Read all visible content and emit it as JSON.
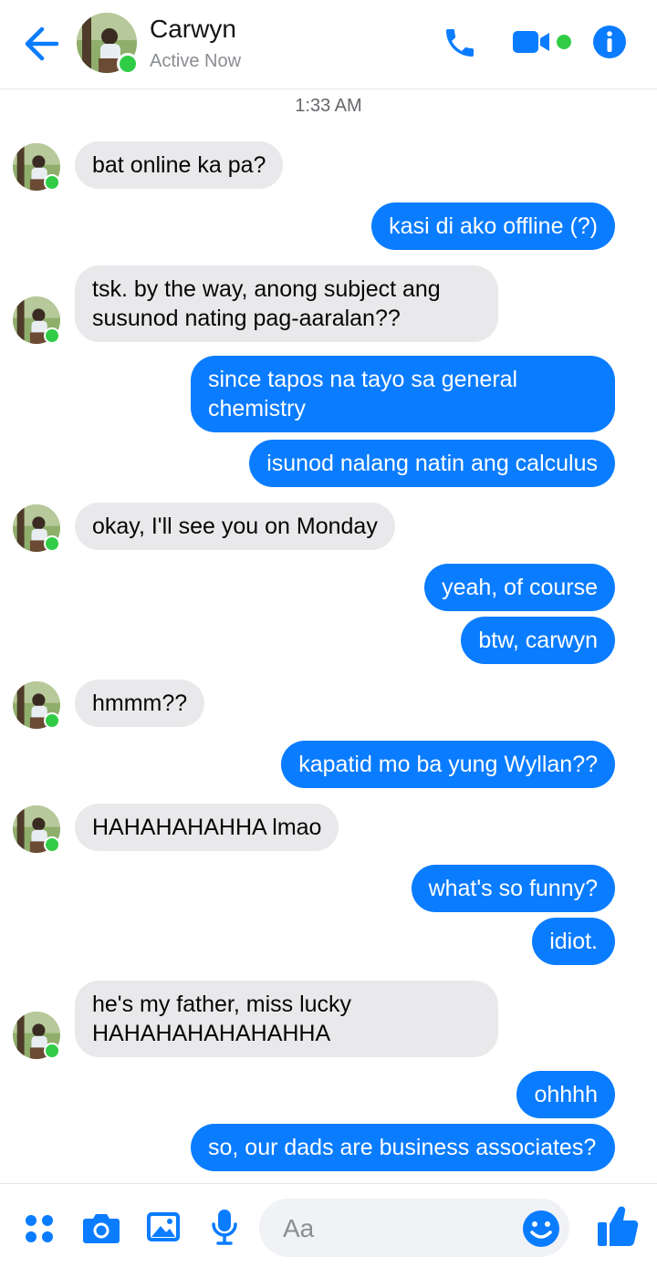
{
  "header": {
    "contact_name": "Carwyn",
    "status": "Active Now"
  },
  "chat": {
    "timestamp": "1:33 AM",
    "messages": [
      {
        "from": "them",
        "text": "bat online ka pa?"
      },
      {
        "from": "me",
        "text": "kasi di ako offline (?)"
      },
      {
        "from": "them",
        "text": "tsk. by the way, anong subject ang susunod nating pag-aaralan??"
      },
      {
        "from": "me",
        "text": "since tapos na tayo sa general chemistry"
      },
      {
        "from": "me",
        "text": "isunod nalang natin ang calculus"
      },
      {
        "from": "them",
        "text": "okay, I'll see you on Monday"
      },
      {
        "from": "me",
        "text": "yeah, of course"
      },
      {
        "from": "me",
        "text": "btw, carwyn"
      },
      {
        "from": "them",
        "text": "hmmm??"
      },
      {
        "from": "me",
        "text": "kapatid mo ba yung Wyllan??"
      },
      {
        "from": "them",
        "text": "HAHAHAHAHHA lmao"
      },
      {
        "from": "me",
        "text": "what's so funny?"
      },
      {
        "from": "me",
        "text": "idiot."
      },
      {
        "from": "them",
        "text": "he's my father, miss lucky HAHAHAHAHAHAHHA"
      },
      {
        "from": "me",
        "text": "ohhhh"
      },
      {
        "from": "me",
        "text": "so, our dads are business associates?"
      }
    ]
  },
  "composer": {
    "placeholder": "Aa"
  },
  "colors": {
    "accent": "#0a7cff",
    "received_bubble": "#e9e9eb",
    "online": "#31cc46"
  },
  "icons": {
    "back": "arrow-left-icon",
    "call": "phone-icon",
    "video": "video-camera-icon",
    "info": "info-icon",
    "menu": "four-dots-icon",
    "camera": "camera-icon",
    "gallery": "image-icon",
    "mic": "microphone-icon",
    "emoji": "smiley-icon",
    "like": "thumbs-up-icon"
  }
}
